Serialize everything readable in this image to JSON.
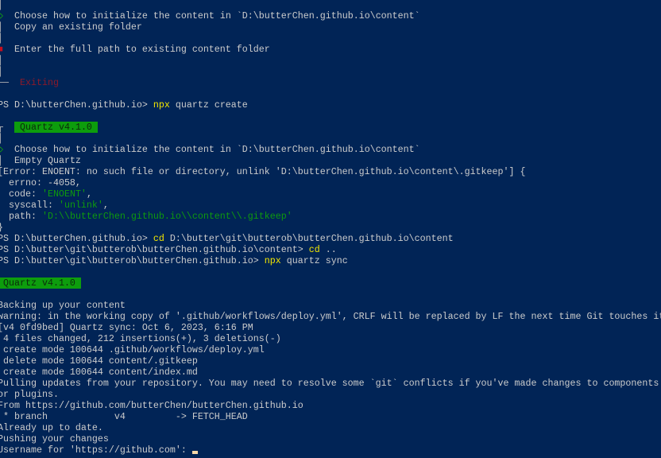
{
  "window": {
    "app": "PowerShell terminal"
  },
  "colors": {
    "background": "#012456",
    "text": "#cccccc",
    "command": "#f2e600",
    "string": "#0e9a0e",
    "badge": "#0d9d0d",
    "error_symbol": "#c50f1f",
    "exiting": "#8b1a2a"
  },
  "terminal": {
    "lines": [
      [
        {
          "t": "│",
          "c": "gutter"
        }
      ],
      [
        {
          "t": "◇",
          "c": "ok"
        },
        {
          "t": "  Choose how to initialize the content in `D:\\butterChen.github.io\\content`",
          "c": "default"
        }
      ],
      [
        {
          "t": "│",
          "c": "gutter"
        },
        {
          "t": "  Copy an existing folder",
          "c": "default"
        }
      ],
      [
        {
          "t": "│",
          "c": "gutter"
        }
      ],
      [
        {
          "t": "■",
          "c": "cancel"
        },
        {
          "t": "  Enter the full path to existing content folder",
          "c": "default"
        }
      ],
      [
        {
          "t": "│",
          "c": "gutter"
        }
      ],
      [
        {
          "t": "│",
          "c": "gutter"
        }
      ],
      [
        {
          "t": "──  ",
          "c": "gutter"
        },
        {
          "t": "Exiting",
          "c": "exit"
        }
      ],
      [],
      [
        {
          "t": "PS D:\\butterChen.github.io> ",
          "c": "default"
        },
        {
          "t": "npx",
          "c": "cmd"
        },
        {
          "t": " quartz create",
          "c": "default"
        }
      ],
      [],
      [
        {
          "t": "┌  ",
          "c": "gutter"
        },
        {
          "t": " Quartz v4.1.0 ",
          "c": "badge"
        }
      ],
      [
        {
          "t": "│",
          "c": "gutter"
        }
      ],
      [
        {
          "t": "◇",
          "c": "ok"
        },
        {
          "t": "  Choose how to initialize the content in `D:\\butterChen.github.io\\content`",
          "c": "default"
        }
      ],
      [
        {
          "t": "│",
          "c": "gutter"
        },
        {
          "t": "  Empty Quartz",
          "c": "default"
        }
      ],
      [
        {
          "t": "[Error: ENOENT: no such file or directory, unlink 'D:\\butterChen.github.io\\content\\.gitkeep'] {",
          "c": "default"
        }
      ],
      [
        {
          "t": "  errno: -4058,",
          "c": "default"
        }
      ],
      [
        {
          "t": "  code: ",
          "c": "default"
        },
        {
          "t": "'ENOENT'",
          "c": "str"
        },
        {
          "t": ",",
          "c": "default"
        }
      ],
      [
        {
          "t": "  syscall: ",
          "c": "default"
        },
        {
          "t": "'unlink'",
          "c": "str"
        },
        {
          "t": ",",
          "c": "default"
        }
      ],
      [
        {
          "t": "  path: ",
          "c": "default"
        },
        {
          "t": "'D:\\\\butterChen.github.io\\\\content\\\\.gitkeep'",
          "c": "str"
        }
      ],
      [
        {
          "t": "}",
          "c": "default"
        }
      ],
      [
        {
          "t": "PS D:\\butterChen.github.io> ",
          "c": "default"
        },
        {
          "t": "cd",
          "c": "cmd"
        },
        {
          "t": " D:\\butter\\git\\butterob\\butterChen.github.io\\content",
          "c": "default"
        }
      ],
      [
        {
          "t": "PS D:\\butter\\git\\butterob\\butterChen.github.io\\content> ",
          "c": "default"
        },
        {
          "t": "cd",
          "c": "cmd"
        },
        {
          "t": " ..",
          "c": "default"
        }
      ],
      [
        {
          "t": "PS D:\\butter\\git\\butterob\\butterChen.github.io> ",
          "c": "default"
        },
        {
          "t": "npx",
          "c": "cmd"
        },
        {
          "t": " quartz sync",
          "c": "default"
        }
      ],
      [],
      [
        {
          "t": " Quartz v4.1.0 ",
          "c": "badge"
        }
      ],
      [],
      [
        {
          "t": "Backing up your content",
          "c": "default"
        }
      ],
      [
        {
          "t": "warning: in the working copy of '.github/workflows/deploy.yml', CRLF will be replaced by LF the next time Git touches it",
          "c": "default"
        }
      ],
      [
        {
          "t": "[v4 0fd9bed] Quartz sync: Oct 6, 2023, 6:16 PM",
          "c": "default"
        }
      ],
      [
        {
          "t": " 4 files changed, 212 insertions(+), 3 deletions(-)",
          "c": "default"
        }
      ],
      [
        {
          "t": " create mode 100644 .github/workflows/deploy.yml",
          "c": "default"
        }
      ],
      [
        {
          "t": " delete mode 100644 content/.gitkeep",
          "c": "default"
        }
      ],
      [
        {
          "t": " create mode 100644 content/index.md",
          "c": "default"
        }
      ],
      [
        {
          "t": "Pulling updates from your repository. You may need to resolve some `git` conflicts if you've made changes to components",
          "c": "default"
        }
      ],
      [
        {
          "t": "or plugins.",
          "c": "default"
        }
      ],
      [
        {
          "t": "From https://github.com/butterChen/butterChen.github.io",
          "c": "default"
        }
      ],
      [
        {
          "t": " * branch            v4         -> FETCH_HEAD",
          "c": "default"
        }
      ],
      [
        {
          "t": "Already up to date.",
          "c": "default"
        }
      ],
      [
        {
          "t": "Pushing your changes",
          "c": "default"
        }
      ],
      [
        {
          "t": "Username for 'https://github.com': ",
          "c": "default"
        }
      ]
    ]
  }
}
